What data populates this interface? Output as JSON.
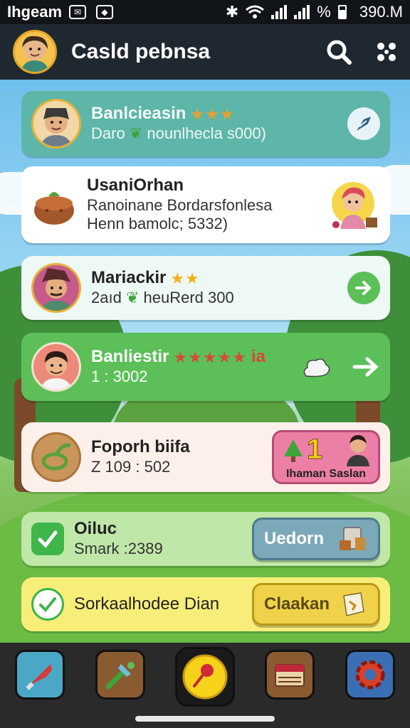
{
  "status_bar": {
    "carrier": "Ihgeam",
    "icon1": "notification-icon",
    "icon2": "message-icon",
    "battery_text": "%",
    "time": "390.M"
  },
  "app_bar": {
    "title": "Casld pebnsa",
    "search_icon": "search-icon",
    "menu_icon": "dots-menu-icon"
  },
  "cards": [
    {
      "title": "Banlcieasin",
      "stars": "★★★",
      "line1_a": "Daro",
      "line1_b": "nounlhecla s000)",
      "action_icon": "share-icon",
      "bg": "#5db6a8"
    },
    {
      "title": "UsaniOrhan",
      "line1": "Ranoinane Bordarsfonlesa",
      "line2": "Henn bamolc; 5332)",
      "bg": "#ffffff"
    },
    {
      "title": "Mariackir",
      "stars": "★★",
      "line1_a": "2aıd",
      "line1_b": "heuRerd 300",
      "action_icon": "arrow-right-icon",
      "bg": "#eef8f5"
    },
    {
      "title": "Banliestir",
      "stars": "★★★★★",
      "stars_suffix": "ia",
      "line1": "1 : 3002",
      "action_icon": "arrow-right-icon",
      "bg": "#5cbf58"
    },
    {
      "title": "Foporh biifa",
      "line1": "Z 109 : 502",
      "badge_number": "1",
      "badge_label": "Ihaman Saslan",
      "bg": "#fdf0ea"
    }
  ],
  "tasks": [
    {
      "title": "Oiluc",
      "subtitle": "Smark :2389",
      "button_label": "Uedorn",
      "bg": "#bfe7a8"
    },
    {
      "title": "Sorkaalhodee Dian",
      "button_label": "Claakan",
      "bg": "#f7ee7a"
    }
  ],
  "nav": {
    "tabs": [
      "battle-icon",
      "tools-icon",
      "compass-icon",
      "book-icon",
      "settings-gear-icon"
    ],
    "active": 2
  },
  "colors": {
    "appbar": "#1f2730",
    "accent_green": "#5cbf58",
    "accent_gold": "#f2b21a",
    "badge_pink": "#ec7fa6"
  }
}
